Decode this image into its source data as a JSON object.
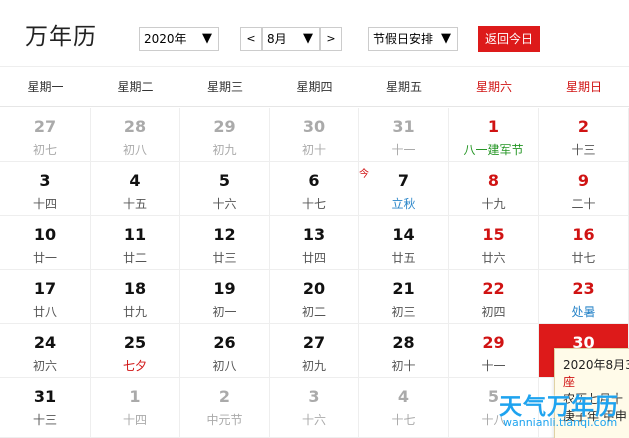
{
  "header": {
    "title": "万年历",
    "year_select": "2020年",
    "prev_label": "<",
    "month_select": "8月",
    "next_label": ">",
    "holiday_select": "节假日安排",
    "today_button": "返回今日",
    "dropdown_arrow": "▼"
  },
  "weekdays": [
    "星期一",
    "星期二",
    "星期三",
    "星期四",
    "星期五",
    "星期六",
    "星期日"
  ],
  "today_mark": "今",
  "rows": [
    [
      {
        "solar": "27",
        "lunar": "初七",
        "state": "other"
      },
      {
        "solar": "28",
        "lunar": "初八",
        "state": "other"
      },
      {
        "solar": "29",
        "lunar": "初九",
        "state": "other"
      },
      {
        "solar": "30",
        "lunar": "初十",
        "state": "other"
      },
      {
        "solar": "31",
        "lunar": "十一",
        "state": "other"
      },
      {
        "solar": "1",
        "lunar": "八一建军节",
        "state": "weekend",
        "lunar_style": "holiday-green"
      },
      {
        "solar": "2",
        "lunar": "十三",
        "state": "weekend"
      }
    ],
    [
      {
        "solar": "3",
        "lunar": "十四"
      },
      {
        "solar": "4",
        "lunar": "十五"
      },
      {
        "solar": "5",
        "lunar": "十六"
      },
      {
        "solar": "6",
        "lunar": "十七"
      },
      {
        "solar": "7",
        "lunar": "立秋",
        "lunar_style": "term"
      },
      {
        "solar": "8",
        "lunar": "十九",
        "state": "weekend"
      },
      {
        "solar": "9",
        "lunar": "二十",
        "state": "weekend"
      }
    ],
    [
      {
        "solar": "10",
        "lunar": "廿一"
      },
      {
        "solar": "11",
        "lunar": "廿二"
      },
      {
        "solar": "12",
        "lunar": "廿三"
      },
      {
        "solar": "13",
        "lunar": "廿四"
      },
      {
        "solar": "14",
        "lunar": "廿五"
      },
      {
        "solar": "15",
        "lunar": "廿六",
        "state": "weekend"
      },
      {
        "solar": "16",
        "lunar": "廿七",
        "state": "weekend"
      }
    ],
    [
      {
        "solar": "17",
        "lunar": "廿八"
      },
      {
        "solar": "18",
        "lunar": "廿九"
      },
      {
        "solar": "19",
        "lunar": "初一"
      },
      {
        "solar": "20",
        "lunar": "初二"
      },
      {
        "solar": "21",
        "lunar": "初三"
      },
      {
        "solar": "22",
        "lunar": "初四",
        "state": "weekend"
      },
      {
        "solar": "23",
        "lunar": "处暑",
        "state": "weekend",
        "lunar_style": "term"
      }
    ],
    [
      {
        "solar": "24",
        "lunar": "初六"
      },
      {
        "solar": "25",
        "lunar": "七夕",
        "lunar_style": "festival"
      },
      {
        "solar": "26",
        "lunar": "初八"
      },
      {
        "solar": "27",
        "lunar": "初九"
      },
      {
        "solar": "28",
        "lunar": "初十"
      },
      {
        "solar": "29",
        "lunar": "十一",
        "state": "weekend"
      },
      {
        "solar": "30",
        "lunar": "",
        "state": "selected"
      }
    ],
    [
      {
        "solar": "31",
        "lunar": "十三"
      },
      {
        "solar": "1",
        "lunar": "十四",
        "state": "other"
      },
      {
        "solar": "2",
        "lunar": "中元节",
        "state": "other"
      },
      {
        "solar": "3",
        "lunar": "十六",
        "state": "other"
      },
      {
        "solar": "4",
        "lunar": "十七",
        "state": "other"
      },
      {
        "solar": "5",
        "lunar": "十八",
        "state": "other"
      },
      {
        "solar": "",
        "lunar": "",
        "state": "other"
      }
    ]
  ],
  "tooltip": {
    "date_line": "2020年8月30",
    "weekday_line": "座",
    "lunar_line": "农历七月十",
    "ganzhi_line": "庚子年 甲申"
  },
  "watermark": {
    "text": "天气万年历",
    "url": "wannianli.tianqi.com"
  },
  "colors": {
    "accent_red": "#dd1a1a",
    "term_blue": "#2b86c9",
    "holiday_green": "#259625"
  }
}
